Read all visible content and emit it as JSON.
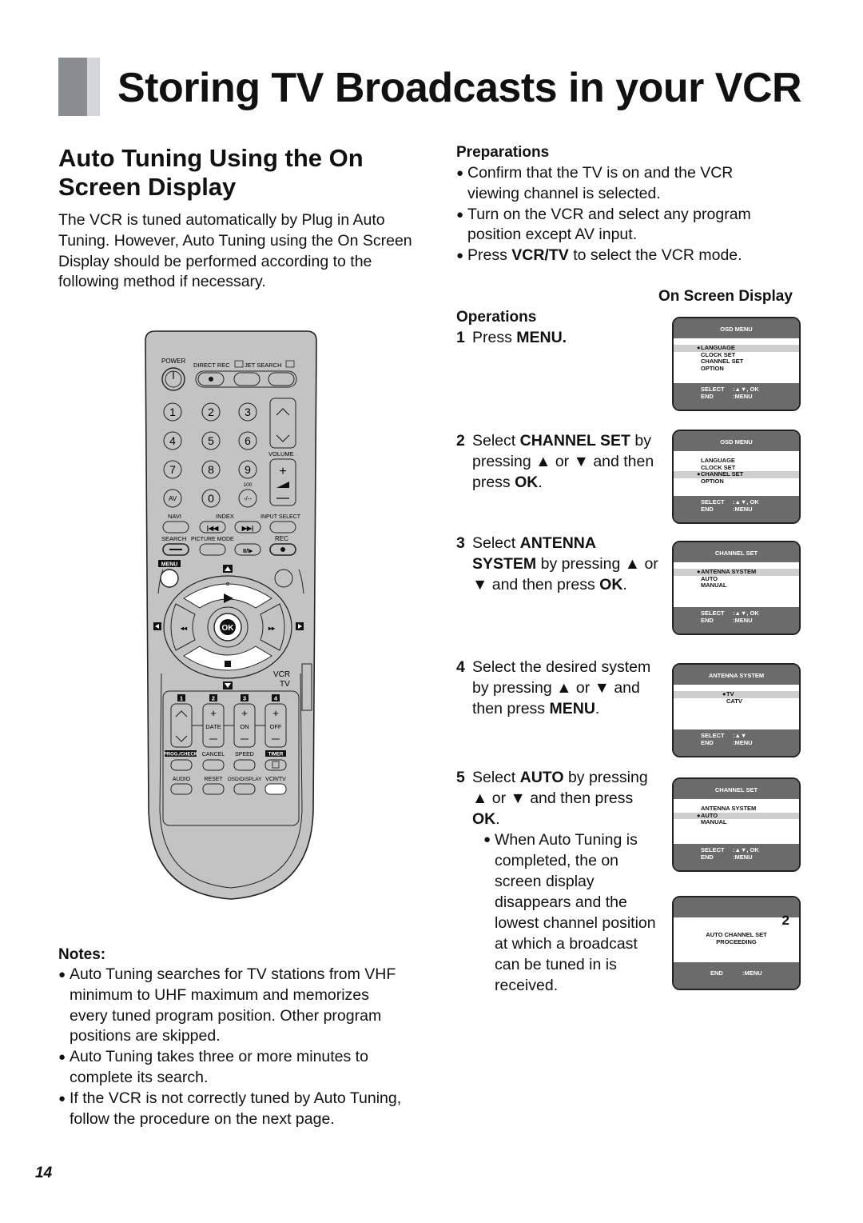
{
  "page": {
    "title": "Storing TV Broadcasts in your VCR",
    "page_number": "14"
  },
  "section": {
    "title": "Auto Tuning Using the On Screen Display",
    "intro": "The VCR is tuned automatically by Plug in Auto Tuning. However, Auto Tuning using the On Screen Display should be performed according to the following method if necessary."
  },
  "preparations": {
    "heading": "Preparations",
    "items": [
      {
        "text": "Confirm that the TV is on and the VCR viewing channel is selected."
      },
      {
        "text": "Turn on the VCR and select any program position except AV input."
      },
      {
        "pre": "Press ",
        "bold": "VCR/TV",
        "post": " to select the VCR mode."
      }
    ]
  },
  "osd_heading": "On Screen Display",
  "operations": {
    "heading": "Operations",
    "steps": [
      {
        "num": "1",
        "parts": [
          {
            "t": "Press "
          },
          {
            "b": "MENU."
          }
        ]
      },
      {
        "num": "2",
        "parts": [
          {
            "t": "Select "
          },
          {
            "b": "CHANNEL SET"
          },
          {
            "t": " by pressing ▲ or ▼ and then press "
          },
          {
            "b": "OK"
          },
          {
            "t": "."
          }
        ]
      },
      {
        "num": "3",
        "parts": [
          {
            "t": "Select "
          },
          {
            "b": "ANTENNA SYSTEM"
          },
          {
            "t": " by pressing ▲ or ▼ and then press "
          },
          {
            "b": "OK"
          },
          {
            "t": "."
          }
        ]
      },
      {
        "num": "4",
        "parts": [
          {
            "t": "Select the desired system by pressing ▲ or ▼ and then press "
          },
          {
            "b": "MENU"
          },
          {
            "t": "."
          }
        ]
      },
      {
        "num": "5",
        "parts": [
          {
            "t": "Select "
          },
          {
            "b": "AUTO"
          },
          {
            "t": " by pressing ▲ or ▼ and then press "
          },
          {
            "b": "OK"
          },
          {
            "t": "."
          }
        ],
        "sub": "When Auto Tuning is completed, the on screen display disappears and the lowest channel position at which a broadcast can be tuned in is received."
      }
    ]
  },
  "osd_screens": [
    {
      "header": "OSD MENU",
      "items": [
        "LANGUAGE",
        "CLOCK SET",
        "CHANNEL SET",
        "OPTION"
      ],
      "selected": 0,
      "footer": [
        [
          "SELECT",
          ":▲▼, OK"
        ],
        [
          "END",
          ":MENU"
        ]
      ]
    },
    {
      "header": "OSD MENU",
      "items": [
        "LANGUAGE",
        "CLOCK SET",
        "CHANNEL SET",
        "OPTION"
      ],
      "selected": 2,
      "footer": [
        [
          "SELECT",
          ":▲▼, OK"
        ],
        [
          "END",
          ":MENU"
        ]
      ]
    },
    {
      "header": "CHANNEL SET",
      "items": [
        "ANTENNA SYSTEM",
        "AUTO",
        "MANUAL"
      ],
      "selected": 0,
      "footer": [
        [
          "SELECT",
          ":▲▼, OK"
        ],
        [
          "END",
          ":MENU"
        ]
      ]
    },
    {
      "header": "ANTENNA SYSTEM",
      "items": [
        "TV",
        "CATV"
      ],
      "selected": 0,
      "centered": true,
      "footer": [
        [
          "SELECT",
          ":▲▼"
        ],
        [
          "END",
          ":MENU"
        ]
      ]
    },
    {
      "header": "CHANNEL SET",
      "items": [
        "ANTENNA SYSTEM",
        "AUTO",
        "MANUAL"
      ],
      "selected": 1,
      "footer": [
        [
          "SELECT",
          ":▲▼, OK"
        ],
        [
          "END",
          ":MENU"
        ]
      ]
    },
    {
      "header": "",
      "channel": "2",
      "message": [
        "AUTO CHANNEL SET",
        "PROCEEDING"
      ],
      "footer": [
        [
          "END",
          ":MENU"
        ]
      ]
    }
  ],
  "notes": {
    "heading": "Notes:",
    "items": [
      "Auto Tuning searches for TV stations from VHF minimum to UHF maximum and memorizes every tuned program position. Other program positions are skipped.",
      "Auto Tuning takes three or more minutes to complete its search.",
      "If the VCR is not correctly tuned by Auto Tuning, follow the procedure on the next page."
    ]
  },
  "remote": {
    "labels": {
      "power": "POWER",
      "direct_rec": "DIRECT REC",
      "jet_search": "JET SEARCH",
      "volume": "VOLUME",
      "hundred": "100",
      "av": "AV",
      "dash": "-/--",
      "navi": "NAVI",
      "index": "INDEX",
      "input_select": "INPUT SELECT",
      "search": "SEARCH",
      "picture_mode": "PICTURE MODE",
      "rec": "REC",
      "menu": "MENU",
      "ok": "OK",
      "vcr": "VCR",
      "tv": "TV",
      "date": "DATE",
      "on": "ON",
      "off": "OFF",
      "prog_check": "PROG./CHECK",
      "cancel": "CANCEL",
      "speed": "SPEED",
      "timer": "TIMER",
      "audio": "AUDIO",
      "reset": "RESET",
      "osd_display": "OSD/DISPLAY",
      "vcr_tv": "VCR/TV"
    },
    "digits": [
      "1",
      "2",
      "3",
      "4",
      "5",
      "6",
      "7",
      "8",
      "9",
      "0"
    ],
    "timer_slots": [
      "1",
      "2",
      "3",
      "4"
    ]
  }
}
